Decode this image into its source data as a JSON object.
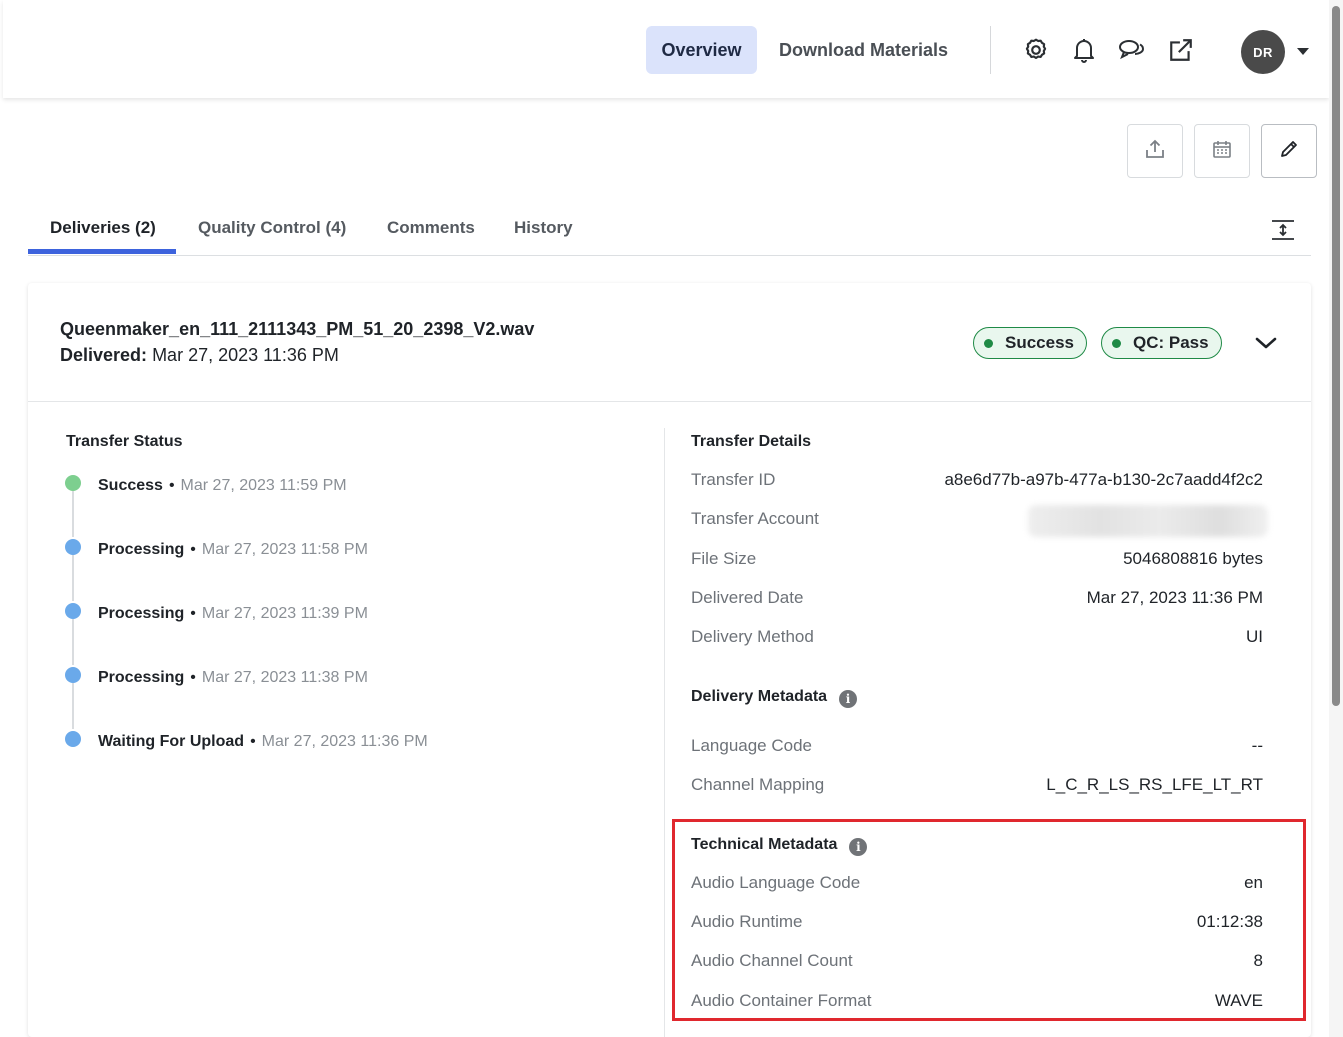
{
  "nav": {
    "overview": "Overview",
    "download_materials": "Download Materials",
    "icons": [
      "settings-icon",
      "bell-icon",
      "chat-icon",
      "external-link-icon"
    ],
    "avatar_initials": "DR"
  },
  "actions": [
    "upload-icon",
    "calendar-icon",
    "pencil-icon"
  ],
  "tabs": {
    "deliveries": "Deliveries (2)",
    "quality_control": "Quality Control (4)",
    "comments": "Comments",
    "history": "History",
    "active": "Deliveries (2)"
  },
  "delivery": {
    "filename": "Queenmaker_en_111_2111343_PM_51_20_2398_V2.wav",
    "delivered_label": "Delivered:",
    "delivered_value": "Mar 27, 2023 11:36 PM",
    "badges": {
      "success": "Success",
      "qc": "QC: Pass"
    }
  },
  "transfer_status": {
    "title": "Transfer Status",
    "events": [
      {
        "status": "Success",
        "time": "Mar 27, 2023 11:59 PM",
        "color": "#7dcf8f"
      },
      {
        "status": "Processing",
        "time": "Mar 27, 2023 11:58 PM",
        "color": "#6aa9ea"
      },
      {
        "status": "Processing",
        "time": "Mar 27, 2023 11:39 PM",
        "color": "#6aa9ea"
      },
      {
        "status": "Processing",
        "time": "Mar 27, 2023 11:38 PM",
        "color": "#6aa9ea"
      },
      {
        "status": "Waiting For Upload",
        "time": "Mar 27, 2023 11:36 PM",
        "color": "#6aa9ea"
      }
    ]
  },
  "transfer_details": {
    "title": "Transfer Details",
    "rows": [
      {
        "label": "Transfer ID",
        "value": "a8e6d77b-a97b-477a-b130-2c7aadd4f2c2"
      },
      {
        "label": "Transfer Account",
        "value": ""
      },
      {
        "label": "File Size",
        "value": "5046808816 bytes"
      },
      {
        "label": "Delivered Date",
        "value": "Mar 27, 2023 11:36 PM"
      },
      {
        "label": "Delivery Method",
        "value": "UI"
      }
    ]
  },
  "delivery_metadata": {
    "title": "Delivery Metadata",
    "rows": [
      {
        "label": "Language Code",
        "value": "--"
      },
      {
        "label": "Channel Mapping",
        "value": "L_C_R_LS_RS_LFE_LT_RT"
      }
    ]
  },
  "technical_metadata": {
    "title": "Technical Metadata",
    "rows": [
      {
        "label": "Audio Language Code",
        "value": "en"
      },
      {
        "label": "Audio Runtime",
        "value": "01:12:38"
      },
      {
        "label": "Audio Channel Count",
        "value": "8"
      },
      {
        "label": "Audio Container Format",
        "value": "WAVE"
      }
    ]
  },
  "colors": {
    "accent": "#3d63dd",
    "success": "#1f8a46",
    "highlight": "#e0282e"
  }
}
